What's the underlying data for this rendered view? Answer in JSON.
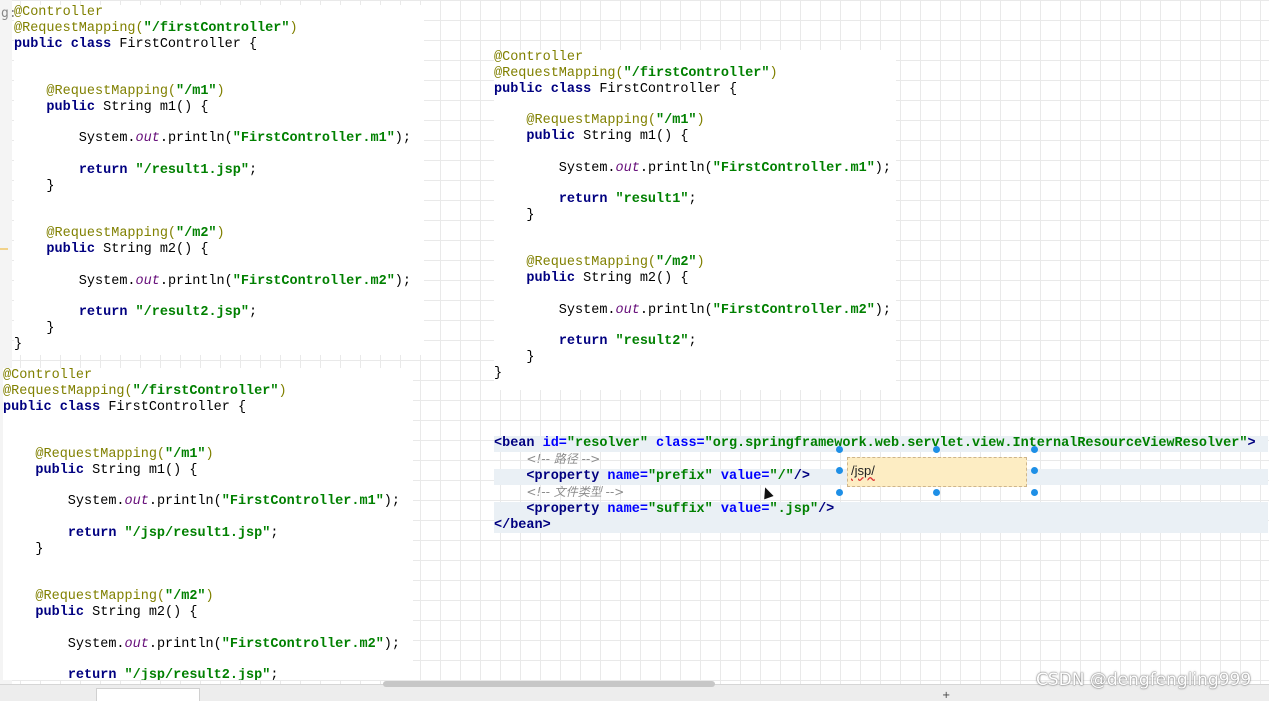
{
  "gutter": {
    "mark": "g:"
  },
  "panels": {
    "a": [
      [
        [
          "ann",
          "@Controller"
        ]
      ],
      [
        [
          "ann",
          "@RequestMapping("
        ],
        [
          "str",
          "\"/firstController\""
        ],
        [
          "ann",
          ")"
        ]
      ],
      [
        [
          "kw",
          "public class "
        ],
        [
          "",
          "FirstController {"
        ]
      ],
      [],
      [],
      [
        [
          "",
          "    "
        ],
        [
          "ann",
          "@RequestMapping("
        ],
        [
          "str",
          "\"/m1\""
        ],
        [
          "ann",
          ")"
        ]
      ],
      [
        [
          "",
          "    "
        ],
        [
          "kw",
          "public "
        ],
        [
          "",
          "String m1() {"
        ]
      ],
      [],
      [
        [
          "",
          "        System."
        ],
        [
          "fld",
          "out"
        ],
        [
          "",
          ".println("
        ],
        [
          "str",
          "\"FirstController.m1\""
        ],
        [
          "",
          ");"
        ]
      ],
      [],
      [
        [
          "",
          "        "
        ],
        [
          "kw",
          "return "
        ],
        [
          "str",
          "\"/result1.jsp\""
        ],
        [
          "",
          ";"
        ]
      ],
      [
        [
          "",
          "    }"
        ]
      ],
      [],
      [],
      [
        [
          "",
          "    "
        ],
        [
          "ann",
          "@RequestMapping("
        ],
        [
          "str",
          "\"/m2\""
        ],
        [
          "ann",
          ")"
        ]
      ],
      [
        [
          "",
          "    "
        ],
        [
          "kw",
          "public "
        ],
        [
          "",
          "String m2() {"
        ]
      ],
      [],
      [
        [
          "",
          "        System."
        ],
        [
          "fld",
          "out"
        ],
        [
          "",
          ".println("
        ],
        [
          "str",
          "\"FirstController.m2\""
        ],
        [
          "",
          ");"
        ]
      ],
      [],
      [
        [
          "",
          "        "
        ],
        [
          "kw",
          "return "
        ],
        [
          "str",
          "\"/result2.jsp\""
        ],
        [
          "",
          ";"
        ]
      ],
      [
        [
          "",
          "    }"
        ]
      ],
      [
        [
          "",
          "}"
        ]
      ]
    ],
    "b": [
      [
        [
          "ann",
          "@Controller"
        ]
      ],
      [
        [
          "ann",
          "@RequestMapping("
        ],
        [
          "str",
          "\"/firstController\""
        ],
        [
          "ann",
          ")"
        ]
      ],
      [
        [
          "kw",
          "public class "
        ],
        [
          "",
          "FirstController {"
        ]
      ],
      [],
      [
        [
          "",
          "    "
        ],
        [
          "ann",
          "@RequestMapping("
        ],
        [
          "str",
          "\"/m1\""
        ],
        [
          "ann",
          ")"
        ]
      ],
      [
        [
          "",
          "    "
        ],
        [
          "kw",
          "public "
        ],
        [
          "",
          "String m1() {"
        ]
      ],
      [],
      [
        [
          "",
          "        System."
        ],
        [
          "fld",
          "out"
        ],
        [
          "",
          ".println("
        ],
        [
          "str",
          "\"FirstController.m1\""
        ],
        [
          "",
          ");"
        ]
      ],
      [],
      [
        [
          "",
          "        "
        ],
        [
          "kw",
          "return "
        ],
        [
          "str",
          "\"result1\""
        ],
        [
          "",
          ";"
        ]
      ],
      [
        [
          "",
          "    }"
        ]
      ],
      [],
      [],
      [
        [
          "",
          "    "
        ],
        [
          "ann",
          "@RequestMapping("
        ],
        [
          "str",
          "\"/m2\""
        ],
        [
          "ann",
          ")"
        ]
      ],
      [
        [
          "",
          "    "
        ],
        [
          "kw",
          "public "
        ],
        [
          "",
          "String m2() {"
        ]
      ],
      [],
      [
        [
          "",
          "        System."
        ],
        [
          "fld",
          "out"
        ],
        [
          "",
          ".println("
        ],
        [
          "str",
          "\"FirstController.m2\""
        ],
        [
          "",
          ");"
        ]
      ],
      [],
      [
        [
          "",
          "        "
        ],
        [
          "kw",
          "return "
        ],
        [
          "str",
          "\"result2\""
        ],
        [
          "",
          ";"
        ]
      ],
      [
        [
          "",
          "    }"
        ]
      ],
      [
        [
          "",
          "}"
        ]
      ]
    ],
    "c": [
      [
        [
          "ann",
          "@Controller"
        ]
      ],
      [
        [
          "ann",
          "@RequestMapping("
        ],
        [
          "str",
          "\"/firstController\""
        ],
        [
          "ann",
          ")"
        ]
      ],
      [
        [
          "kw",
          "public class "
        ],
        [
          "",
          "FirstController {"
        ]
      ],
      [],
      [],
      [
        [
          "",
          "    "
        ],
        [
          "ann",
          "@RequestMapping("
        ],
        [
          "str",
          "\"/m1\""
        ],
        [
          "ann",
          ")"
        ]
      ],
      [
        [
          "",
          "    "
        ],
        [
          "kw",
          "public "
        ],
        [
          "",
          "String m1() {"
        ]
      ],
      [],
      [
        [
          "",
          "        System."
        ],
        [
          "fld",
          "out"
        ],
        [
          "",
          ".println("
        ],
        [
          "str",
          "\"FirstController.m1\""
        ],
        [
          "",
          ");"
        ]
      ],
      [],
      [
        [
          "",
          "        "
        ],
        [
          "kw",
          "return "
        ],
        [
          "str",
          "\"/jsp/result1.jsp\""
        ],
        [
          "",
          ";"
        ]
      ],
      [
        [
          "",
          "    }"
        ]
      ],
      [],
      [],
      [
        [
          "",
          "    "
        ],
        [
          "ann",
          "@RequestMapping("
        ],
        [
          "str",
          "\"/m2\""
        ],
        [
          "ann",
          ")"
        ]
      ],
      [
        [
          "",
          "    "
        ],
        [
          "kw",
          "public "
        ],
        [
          "",
          "String m2() {"
        ]
      ],
      [],
      [
        [
          "",
          "        System."
        ],
        [
          "fld",
          "out"
        ],
        [
          "",
          ".println("
        ],
        [
          "str",
          "\"FirstController.m2\""
        ],
        [
          "",
          ");"
        ]
      ],
      [],
      [
        [
          "",
          "        "
        ],
        [
          "kw",
          "return "
        ],
        [
          "str",
          "\"/jsp/result2.jsp\""
        ],
        [
          "",
          ";"
        ]
      ]
    ],
    "d": [
      [
        [
          "tag",
          "<bean "
        ],
        [
          "attr",
          "id="
        ],
        [
          "aval",
          "\"resolver\" "
        ],
        [
          "attr",
          "class="
        ],
        [
          "aval",
          "\"org.springframework.web.servlet.view.InternalResourceViewResolver\""
        ],
        [
          "tag",
          ">"
        ]
      ],
      [
        [
          "",
          "    "
        ],
        [
          "cmt",
          "<!-- 路径 -->"
        ]
      ],
      [
        [
          "",
          "    "
        ],
        [
          "tag",
          "<property "
        ],
        [
          "attr",
          "name="
        ],
        [
          "aval",
          "\"prefix\" "
        ],
        [
          "attr",
          "value="
        ],
        [
          "aval",
          "\"/\""
        ],
        [
          "tag",
          "/>"
        ]
      ],
      [
        [
          "",
          "    "
        ],
        [
          "cmt",
          "<!-- 文件类型 -->"
        ]
      ],
      [
        [
          "",
          "    "
        ],
        [
          "tag",
          "<property "
        ],
        [
          "attr",
          "name="
        ],
        [
          "aval",
          "\"suffix\" "
        ],
        [
          "attr",
          "value="
        ],
        [
          "aval",
          "\".jsp\""
        ],
        [
          "tag",
          "/>"
        ]
      ],
      [
        [
          "tag",
          "</bean>"
        ]
      ]
    ]
  },
  "text_box": {
    "text": "/jsp/"
  },
  "watermark": "CSDN @dengfengling999",
  "footer": {
    "plus": "+"
  },
  "colors": {
    "grid": "#e9e9e9",
    "shape_fill": "#fdedc3",
    "handle": "#1e8fe6"
  }
}
